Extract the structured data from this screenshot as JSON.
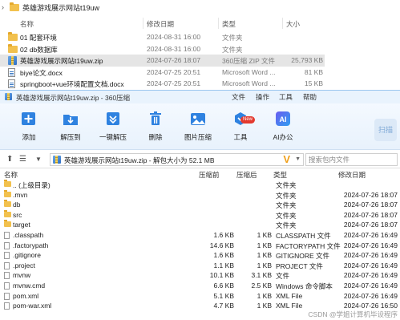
{
  "explorer": {
    "title": "英雄游戏展示网站t19uw",
    "columns": {
      "name": "名称",
      "date": "修改日期",
      "type": "类型",
      "size": "大小"
    },
    "rows": [
      {
        "name": "01 配套环境",
        "date": "2024-08-31 16:00",
        "type": "文件夹",
        "size": "",
        "icon": "folder-icon"
      },
      {
        "name": "02 db数据库",
        "date": "2024-08-31 16:00",
        "type": "文件夹",
        "size": "",
        "icon": "folder-icon"
      },
      {
        "name": "英雄游戏展示网站t19uw.zip",
        "date": "2024-07-26 18:07",
        "type": "360压缩 ZIP 文件",
        "size": "25,793 KB",
        "icon": "zip-icon"
      },
      {
        "name": "biye论文.docx",
        "date": "2024-07-25 20:51",
        "type": "Microsoft Word ...",
        "size": "81 KB",
        "icon": "word-doc-icon"
      },
      {
        "name": "springboot+vue环境配置文档.docx",
        "date": "2024-07-25 20:51",
        "type": "Microsoft Word ...",
        "size": "15 KB",
        "icon": "word-doc-icon"
      }
    ]
  },
  "zip_window": {
    "title": "英雄游戏展示网站t19uw.zip - 360压缩",
    "menu": [
      "文件",
      "操作",
      "工具",
      "帮助"
    ],
    "toolbar": [
      {
        "label": "添加",
        "icon": "add-icon"
      },
      {
        "label": "解压到",
        "icon": "extract-to-icon"
      },
      {
        "label": "一键解压",
        "icon": "one-click-extract-icon"
      },
      {
        "label": "删除",
        "icon": "delete-icon"
      },
      {
        "label": "图片压缩",
        "icon": "image-compress-icon"
      },
      {
        "label": "工具",
        "icon": "tools-icon"
      },
      {
        "label": "AI办公",
        "icon": "ai-office-icon"
      }
    ],
    "new_badge": "New",
    "scan_label": "扫描",
    "address": "英雄游戏展示网站t19uw.zip - 解包大小为 52.1 MB",
    "search_placeholder": "搜索包内文件",
    "columns": {
      "name": "名称",
      "size": "压缩前",
      "compressed": "压缩后",
      "type": "类型",
      "date": "修改日期"
    },
    "rows": [
      {
        "name": ".. (上级目录)",
        "size": "",
        "compressed": "",
        "type": "文件夹",
        "date": "",
        "icon": "folder-icon"
      },
      {
        "name": ".mvn",
        "size": "",
        "compressed": "",
        "type": "文件夹",
        "date": "2024-07-26 18:07",
        "icon": "folder-icon"
      },
      {
        "name": "db",
        "size": "",
        "compressed": "",
        "type": "文件夹",
        "date": "2024-07-26 18:07",
        "icon": "folder-icon"
      },
      {
        "name": "src",
        "size": "",
        "compressed": "",
        "type": "文件夹",
        "date": "2024-07-26 18:07",
        "icon": "folder-icon"
      },
      {
        "name": "target",
        "size": "",
        "compressed": "",
        "type": "文件夹",
        "date": "2024-07-26 18:07",
        "icon": "folder-icon"
      },
      {
        "name": ".classpath",
        "size": "1.6 KB",
        "compressed": "1 KB",
        "type": "CLASSPATH 文件",
        "date": "2024-07-26 16:49",
        "icon": "file-icon"
      },
      {
        "name": ".factorypath",
        "size": "14.6 KB",
        "compressed": "1 KB",
        "type": "FACTORYPATH 文件",
        "date": "2024-07-26 16:49",
        "icon": "file-icon"
      },
      {
        "name": ".gitignore",
        "size": "1.6 KB",
        "compressed": "1 KB",
        "type": "GITIGNORE 文件",
        "date": "2024-07-26 16:49",
        "icon": "file-icon"
      },
      {
        "name": ".project",
        "size": "1.1 KB",
        "compressed": "1 KB",
        "type": "PROJECT 文件",
        "date": "2024-07-26 16:49",
        "icon": "file-icon"
      },
      {
        "name": "mvnw",
        "size": "10.1 KB",
        "compressed": "3.1 KB",
        "type": "文件",
        "date": "2024-07-26 16:49",
        "icon": "file-icon"
      },
      {
        "name": "mvnw.cmd",
        "size": "6.6 KB",
        "compressed": "2.5 KB",
        "type": "Windows 命令脚本",
        "date": "2024-07-26 16:49",
        "icon": "file-icon"
      },
      {
        "name": "pom.xml",
        "size": "5.1 KB",
        "compressed": "1 KB",
        "type": "XML File",
        "date": "2024-07-26 16:49",
        "icon": "file-icon"
      },
      {
        "name": "pom-war.xml",
        "size": "4.7 KB",
        "compressed": "1 KB",
        "type": "XML File",
        "date": "2024-07-26 16:50",
        "icon": "file-icon"
      }
    ]
  },
  "watermark": "CSDN @学姐计算机毕设程序",
  "colors": {
    "accent": "#2f82e0",
    "folder": "#f2c14e",
    "title_bg": "#e9f3fd"
  }
}
